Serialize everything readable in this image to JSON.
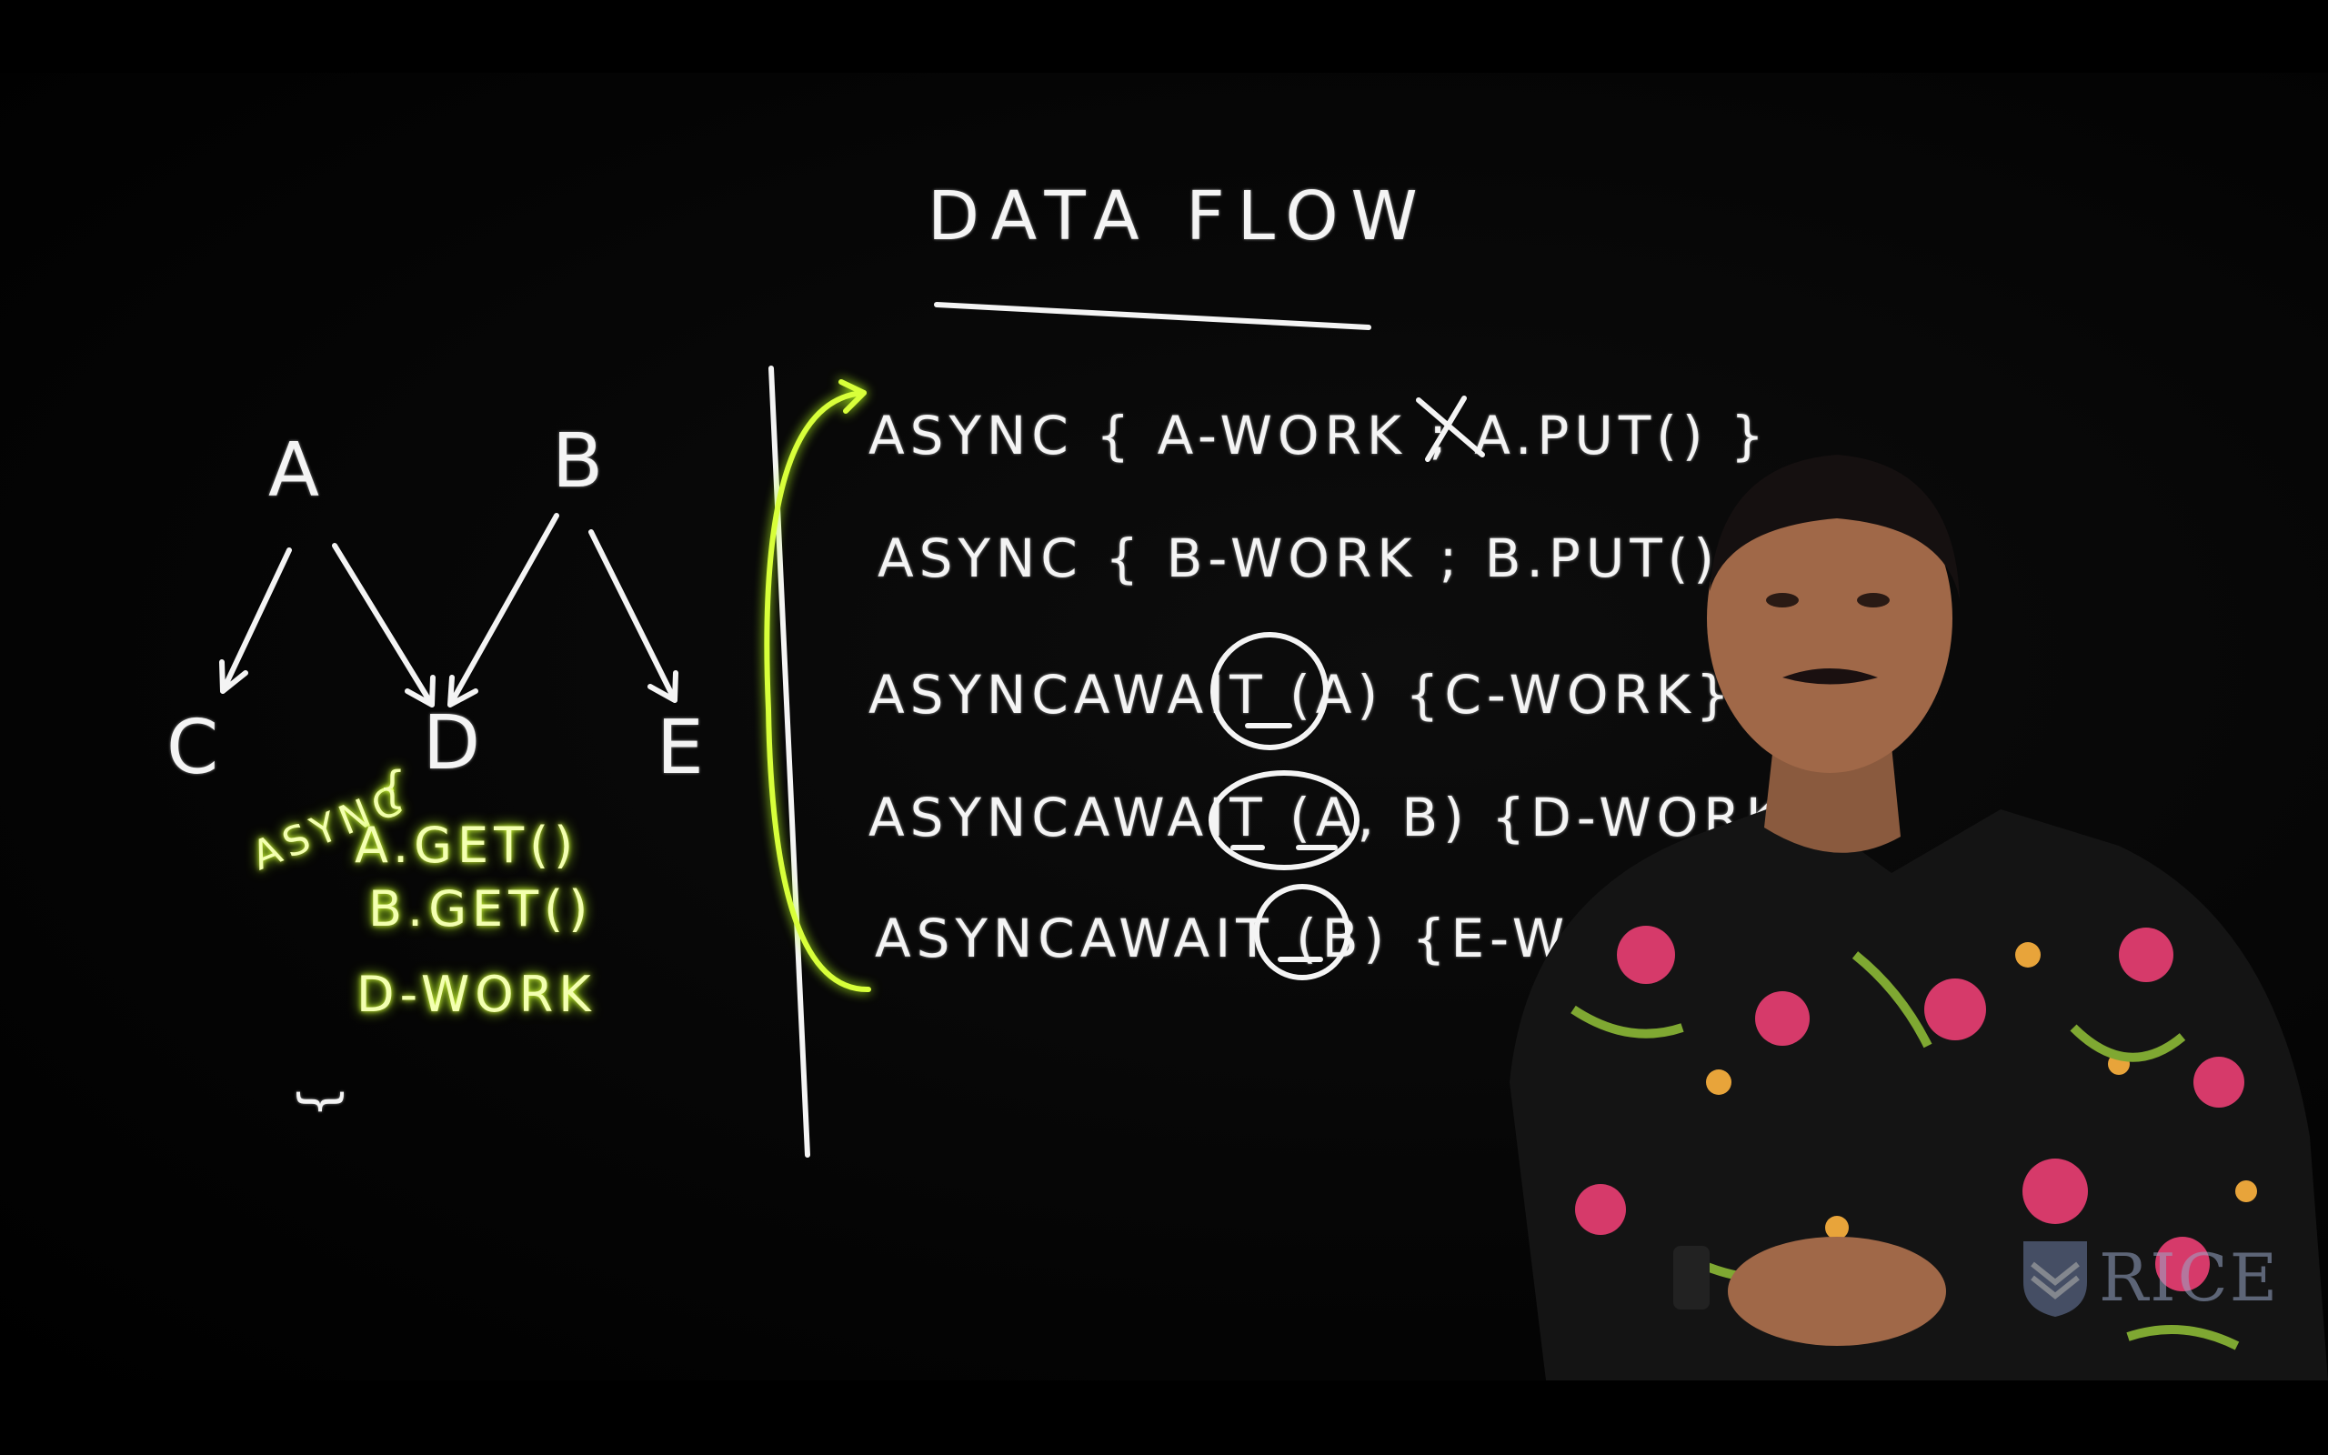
{
  "video": {
    "title_text": "DATA FLOW",
    "graph_nodes": {
      "a": "A",
      "b": "B",
      "c": "C",
      "d": "D",
      "e": "E"
    },
    "d_code": {
      "async_label": "ASYNC",
      "brace_open": "{",
      "line1": "A.GET()",
      "line2": "B.GET()",
      "line3": "D-WORK",
      "brace_close": "}"
    },
    "code_lines": [
      "ASYNC { A-WORK ; A.PUT() }",
      "ASYNC { B-WORK ; B.PUT() }",
      "ASYNCAWAIT (A) {C-WORK}",
      "ASYNCAWAIT (A, B) {D-WORK}",
      "ASYNCAWAIT (B) {E-WORK}"
    ],
    "logo_text": "RICE",
    "colors": {
      "board": "#000000",
      "chalk_white": "#f4f4f4",
      "highlighter": "#d8ff3a",
      "shirt": "#141414",
      "skin": "#a06848"
    }
  }
}
